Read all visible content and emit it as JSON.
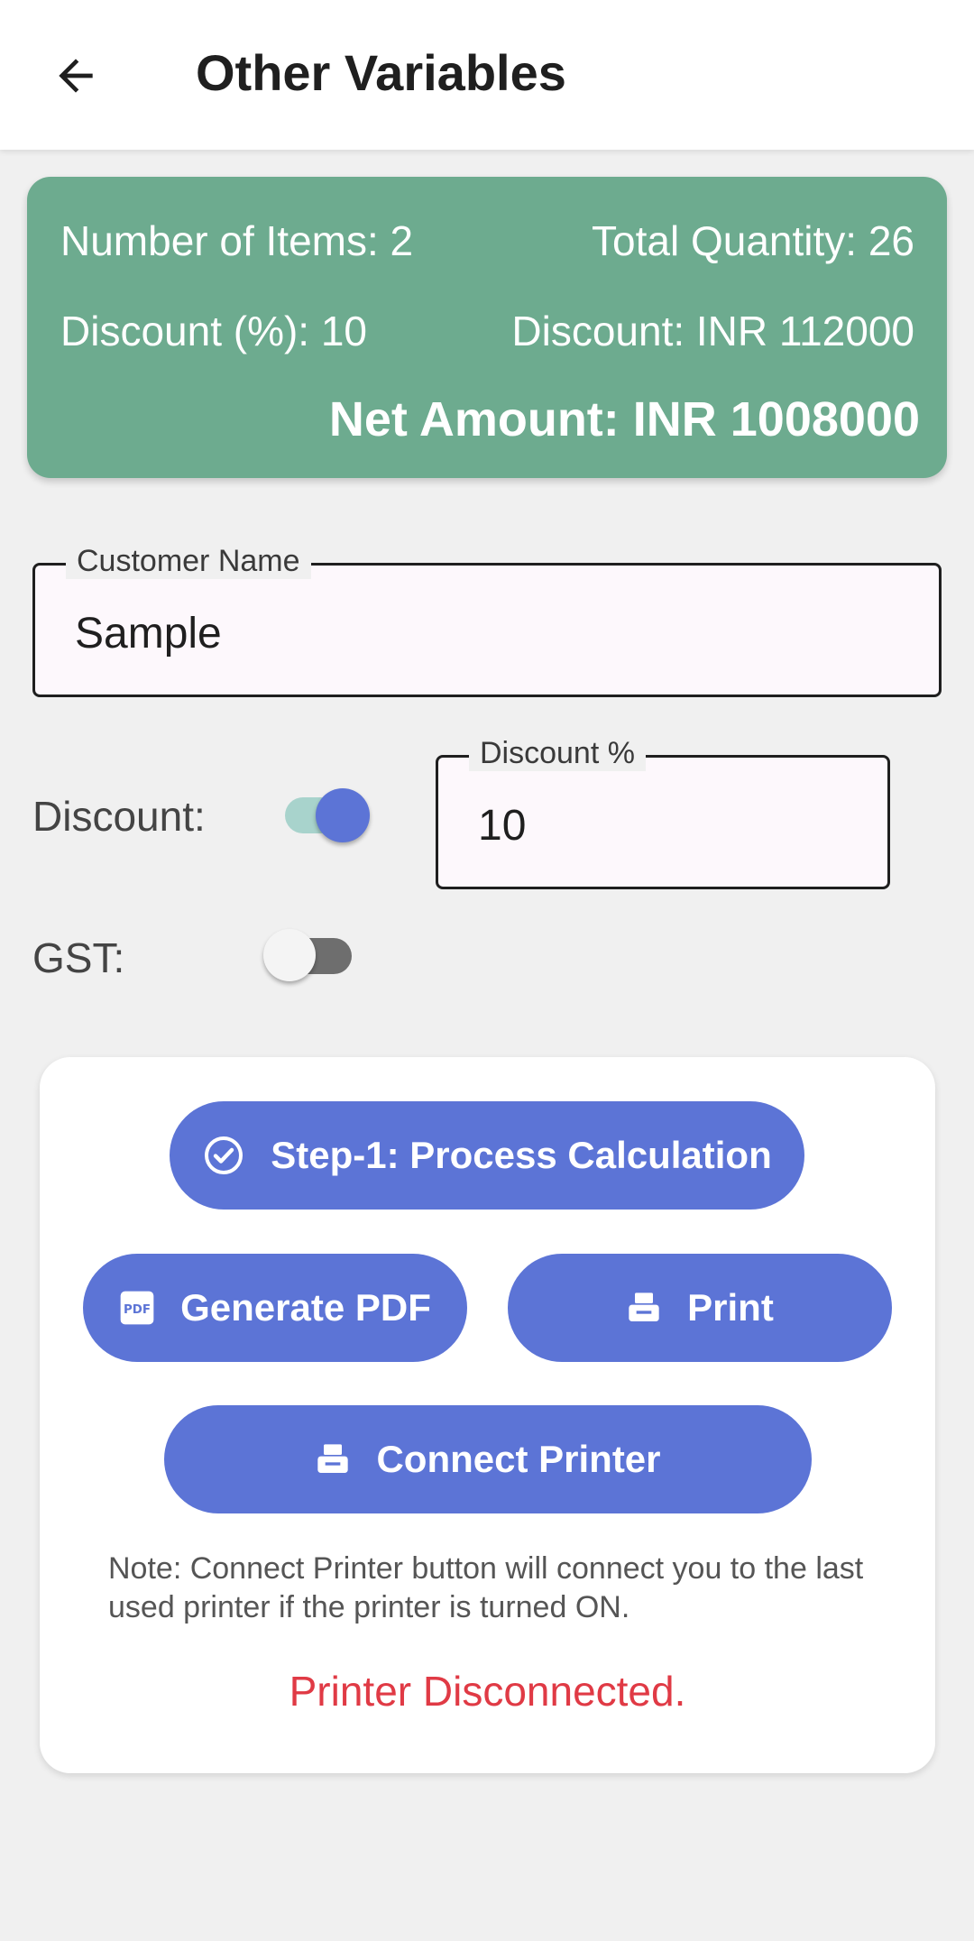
{
  "appbar": {
    "title": "Other Variables",
    "back_icon": "arrow-left-icon"
  },
  "summary": {
    "items": "Number of Items: 2",
    "quantity": "Total Quantity: 26",
    "discount_percent": "Discount (%): 10",
    "discount_amount": "Discount: INR 112000",
    "net_amount": "Net Amount: INR 1008000",
    "background": "#6dab8f"
  },
  "customer": {
    "label": "Customer Name",
    "value": "Sample"
  },
  "discount": {
    "label": "Discount:",
    "enabled": true,
    "field_label": "Discount %",
    "value": "10"
  },
  "gst": {
    "label": "GST:",
    "enabled": false
  },
  "actions": {
    "step1": "Step-1: Process Calculation",
    "generate_pdf": "Generate PDF",
    "print": "Print",
    "connect_printer": "Connect Printer",
    "accent": "#5c74d6"
  },
  "note": "Note: Connect Printer button will connect you to the last used printer if the printer is turned ON.",
  "printer_status": {
    "text": "Printer Disconnected.",
    "color": "#e03a45"
  }
}
